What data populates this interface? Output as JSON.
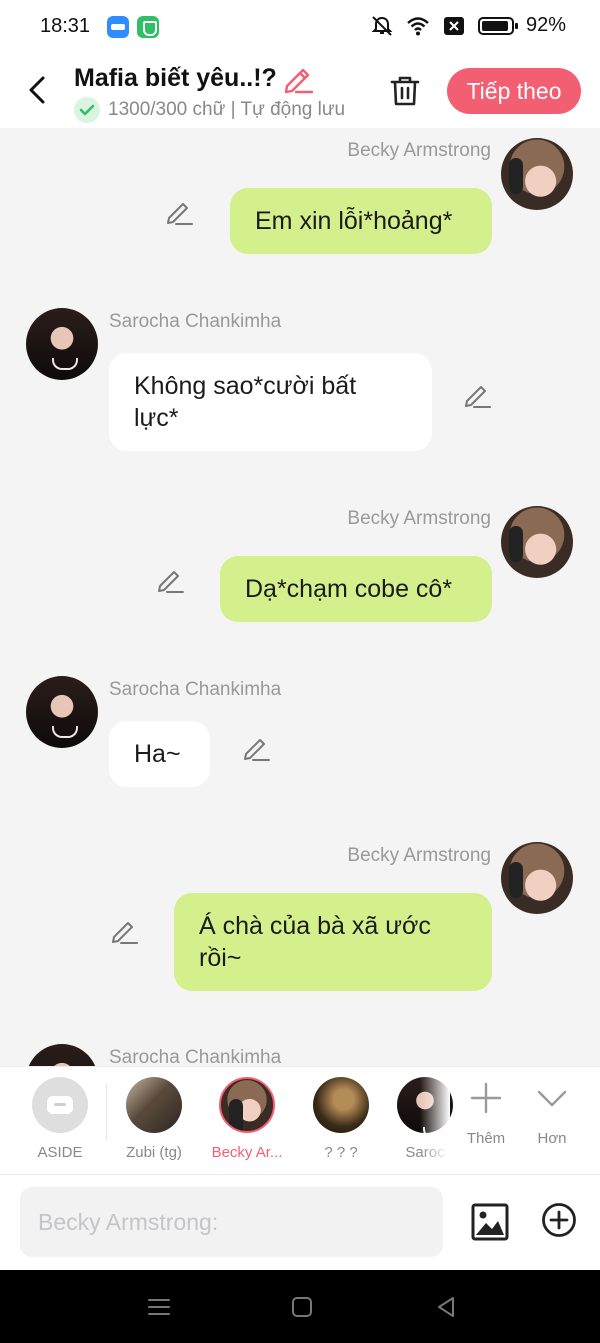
{
  "status_bar": {
    "time": "18:31",
    "battery": "92%",
    "icons": [
      "novel-toon-app-icon",
      "shield-app-icon",
      "mute-icon",
      "wifi-icon",
      "sim-off-icon",
      "battery-icon"
    ]
  },
  "header": {
    "title": "Mafia biết yêu..!?",
    "meta": "1300/300 chữ | Tự động lưu",
    "next_label": "Tiếp theo",
    "accent": "#f25f73"
  },
  "messages": [
    {
      "sender": "Becky Armstrong",
      "side": "right",
      "text": "Em xin lỗi*hoảng*",
      "bubble_color": "#d4f08c"
    },
    {
      "sender": "Sarocha Chankimha",
      "side": "left",
      "text": "Không sao*cười bất lực*",
      "bubble_color": "#ffffff"
    },
    {
      "sender": "Becky Armstrong",
      "side": "right",
      "text": "Dạ*chạm cobe cô*",
      "bubble_color": "#d4f08c"
    },
    {
      "sender": "Sarocha Chankimha",
      "side": "left",
      "text": "Ha~",
      "bubble_color": "#ffffff"
    },
    {
      "sender": "Becky Armstrong",
      "side": "right",
      "text": "Á chà của bà xã ước rồi~",
      "bubble_color": "#d4f08c"
    },
    {
      "sender": "Sarocha Chankimha",
      "side": "left",
      "text": ""
    }
  ],
  "characters": [
    {
      "label": "ASIDE"
    },
    {
      "label": "Zubi (tg)"
    },
    {
      "label": "Becky Ar...",
      "active": true
    },
    {
      "label": "? ? ?"
    },
    {
      "label": "Saroc"
    }
  ],
  "tools": {
    "add_label": "Thêm",
    "more_label": "Hơn"
  },
  "input": {
    "placeholder": "Becky Armstrong:"
  }
}
